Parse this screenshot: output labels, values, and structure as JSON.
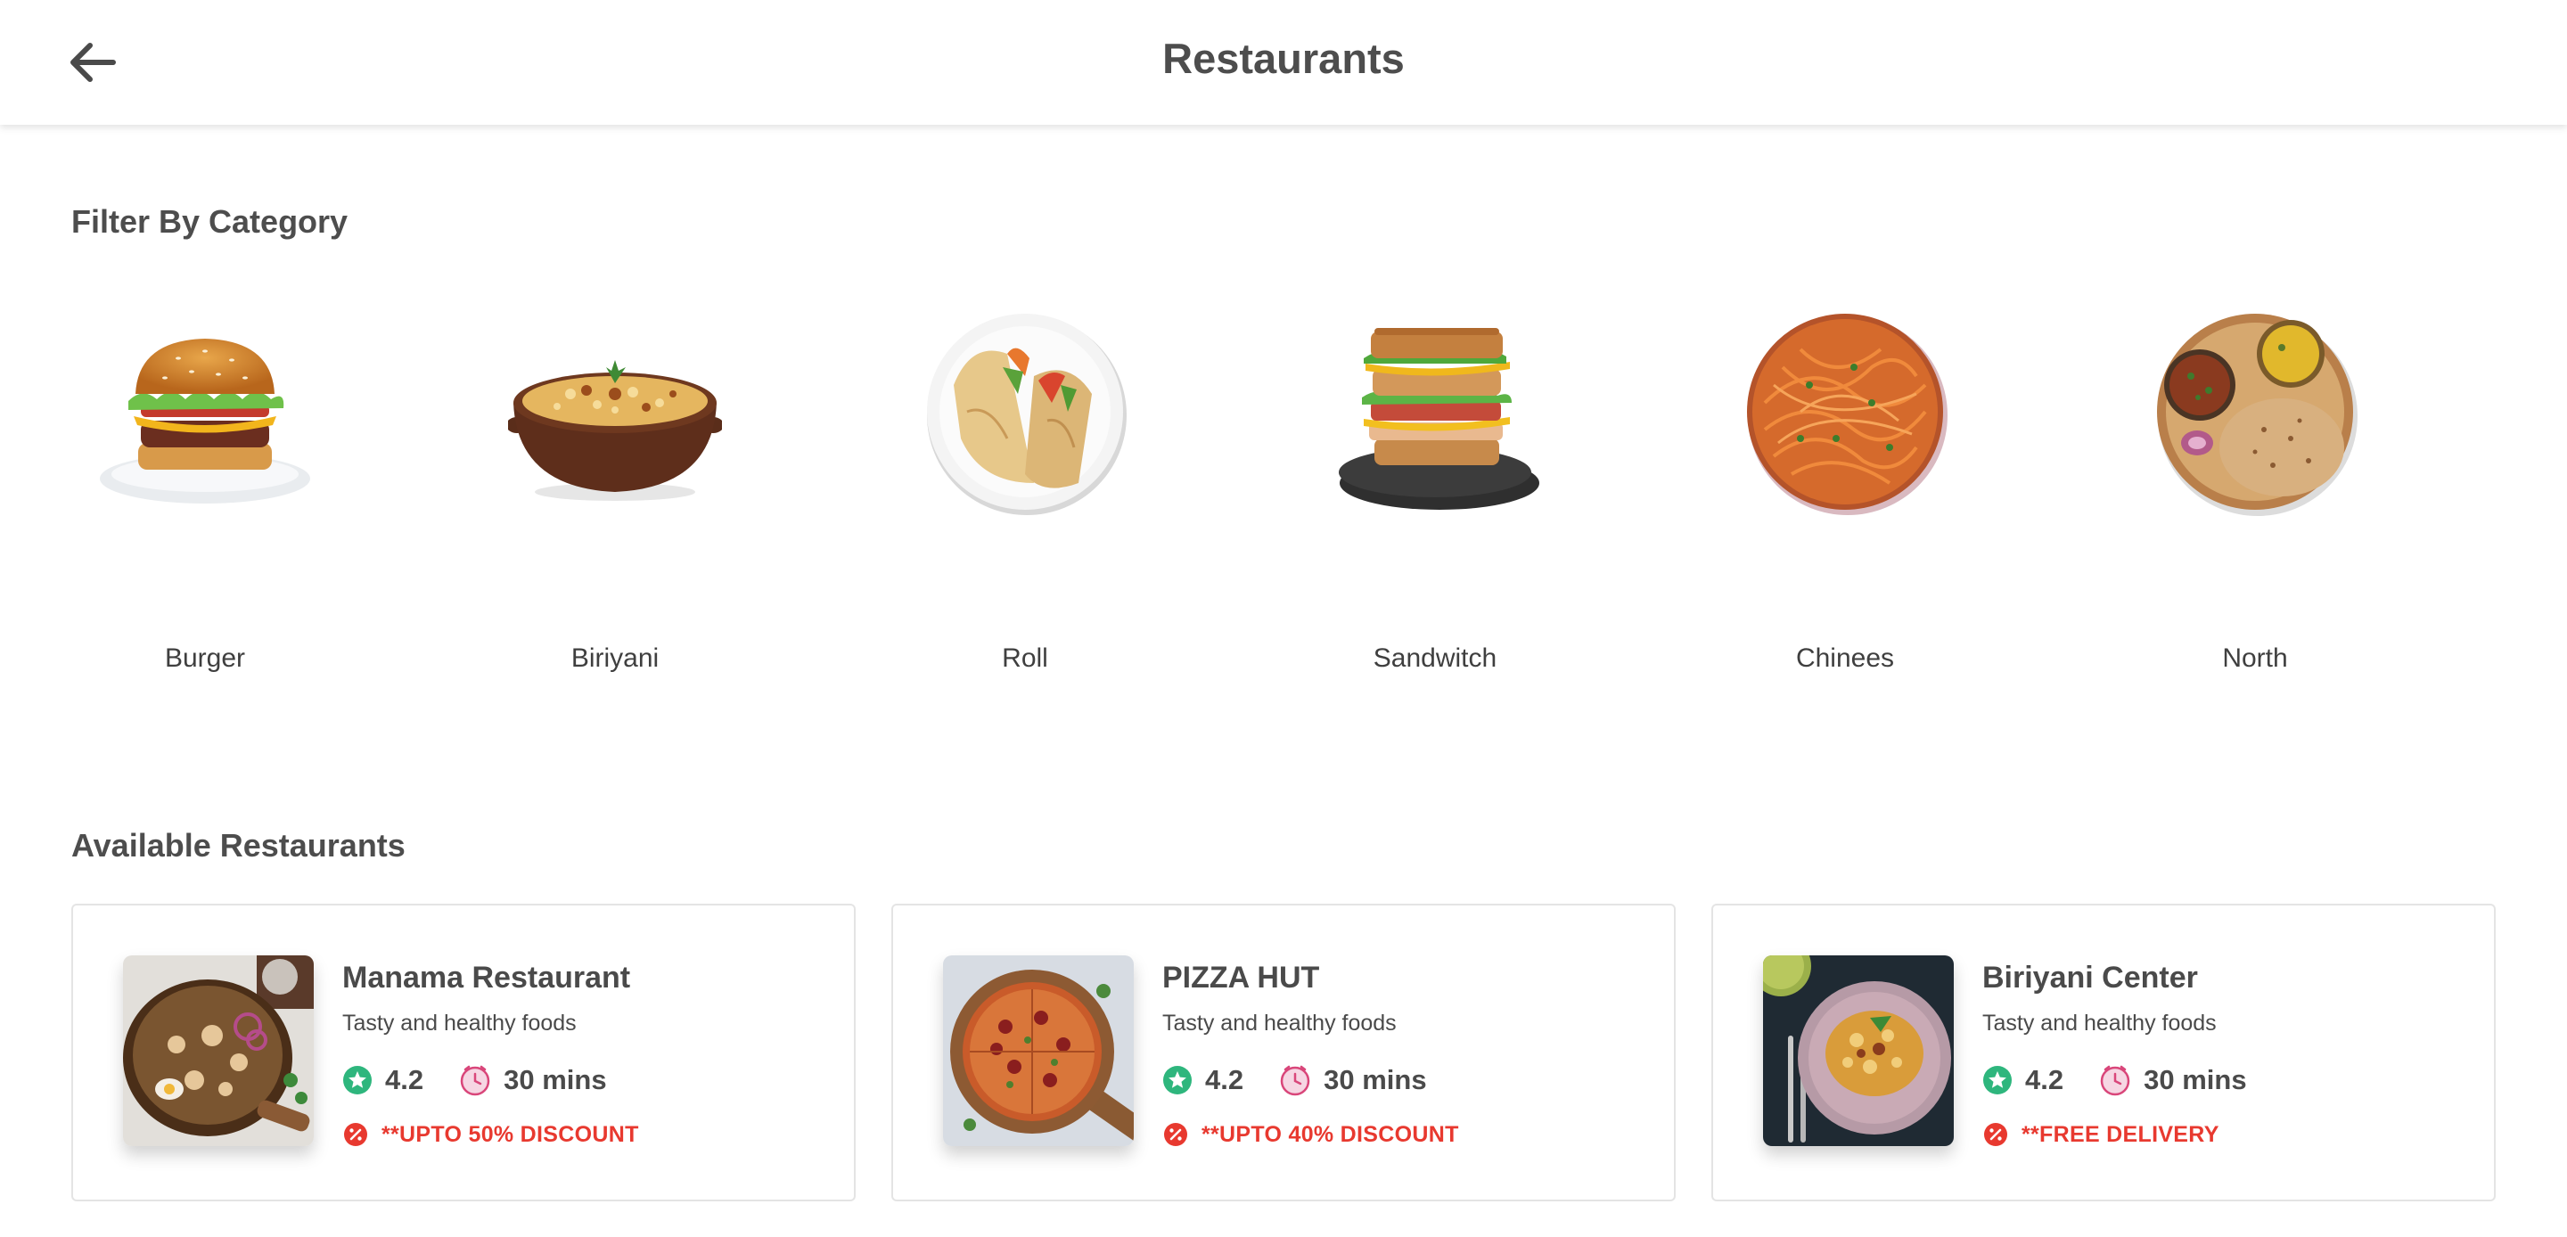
{
  "header": {
    "title": "Restaurants",
    "back_icon": "arrow-left-icon"
  },
  "categories": {
    "title": "Filter By Category",
    "items": [
      {
        "label": "Burger",
        "icon": "burger-image"
      },
      {
        "label": "Biriyani",
        "icon": "biriyani-image"
      },
      {
        "label": "Roll",
        "icon": "roll-image"
      },
      {
        "label": "Sandwitch",
        "icon": "sandwich-image"
      },
      {
        "label": "Chinees",
        "icon": "noodles-image"
      },
      {
        "label": "North",
        "icon": "thali-image"
      }
    ]
  },
  "restaurants": {
    "title": "Available Restaurants",
    "items": [
      {
        "name": "Manama Restaurant",
        "description": "Tasty and healthy foods",
        "rating": "4.2",
        "time": "30 mins",
        "promo": "**UPTO 50% DISCOUNT"
      },
      {
        "name": "PIZZA HUT",
        "description": "Tasty and healthy foods",
        "rating": "4.2",
        "time": "30 mins",
        "promo": "**UPTO 40% DISCOUNT"
      },
      {
        "name": "Biriyani Center",
        "description": "Tasty and healthy foods",
        "rating": "4.2",
        "time": "30 mins",
        "promo": "**FREE DELIVERY"
      }
    ]
  },
  "colors": {
    "rating_green": "#2eb67d",
    "clock_pink": "#d9467a",
    "promo_red": "#e8392f",
    "text_dark": "#4a4a4a"
  }
}
